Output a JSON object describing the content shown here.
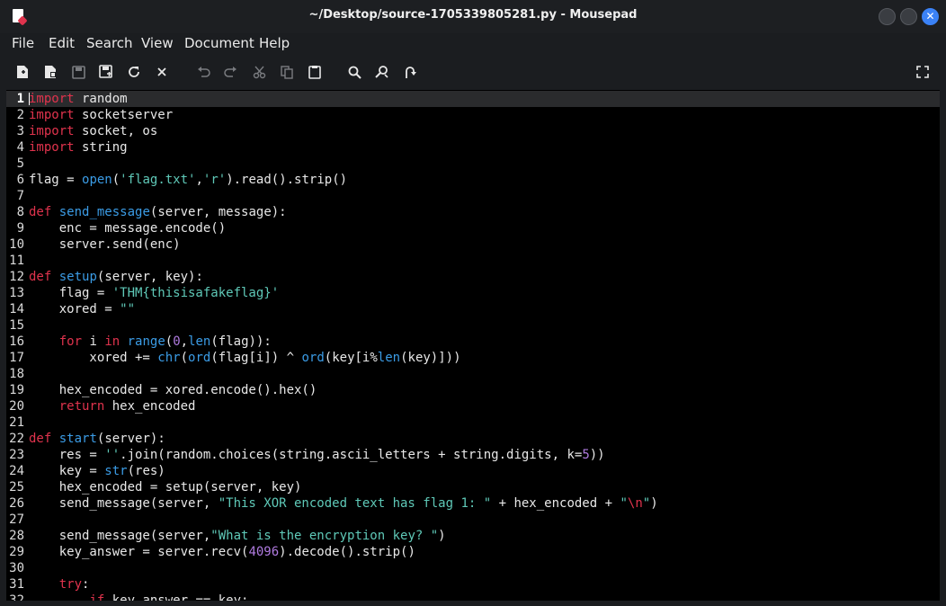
{
  "window": {
    "title": "~/Desktop/source-1705339805281.py - Mousepad",
    "close_glyph": "✕"
  },
  "menu": [
    "File",
    "Edit",
    "Search",
    "View",
    "Document",
    "Help"
  ],
  "toolbar": {
    "new_icon": "new-document-icon",
    "new_window_icon": "new-window-icon",
    "save_icon": "save-icon",
    "save_as_icon": "save-as-icon",
    "reload_icon": "reload-icon",
    "close_icon": "close-icon",
    "undo_icon": "undo-icon",
    "redo_icon": "redo-icon",
    "cut_icon": "cut-icon",
    "copy_icon": "copy-icon",
    "paste_icon": "paste-icon",
    "find_icon": "find-icon",
    "replace_icon": "find-replace-icon",
    "goto_icon": "go-to-line-icon",
    "fullscreen_icon": "fullscreen-icon"
  },
  "colors": {
    "keyword": "#e0334d",
    "function": "#3b9ce6",
    "string": "#5fc9b8",
    "number": "#b07be0",
    "accent": "#3b82f6"
  },
  "editor": {
    "current_line": 1,
    "lines": [
      [
        [
          "kw",
          "import"
        ],
        [
          "p",
          " random"
        ]
      ],
      [
        [
          "kw",
          "import"
        ],
        [
          "p",
          " socketserver"
        ]
      ],
      [
        [
          "kw",
          "import"
        ],
        [
          "p",
          " socket, os"
        ]
      ],
      [
        [
          "kw",
          "import"
        ],
        [
          "p",
          " string"
        ]
      ],
      [],
      [
        [
          "p",
          "flag = "
        ],
        [
          "fn",
          "open"
        ],
        [
          "p",
          "("
        ],
        [
          "str",
          "'flag.txt'"
        ],
        [
          "p",
          ","
        ],
        [
          "str",
          "'r'"
        ],
        [
          "p",
          ").read().strip()"
        ]
      ],
      [],
      [
        [
          "kw",
          "def"
        ],
        [
          "p",
          " "
        ],
        [
          "fn",
          "send_message"
        ],
        [
          "p",
          "(server, message):"
        ]
      ],
      [
        [
          "p",
          "    enc = message.encode()"
        ]
      ],
      [
        [
          "p",
          "    server.send(enc)"
        ]
      ],
      [],
      [
        [
          "kw",
          "def"
        ],
        [
          "p",
          " "
        ],
        [
          "fn",
          "setup"
        ],
        [
          "p",
          "(server, key):"
        ]
      ],
      [
        [
          "p",
          "    flag = "
        ],
        [
          "str",
          "'THM{thisisafakeflag}'"
        ]
      ],
      [
        [
          "p",
          "    xored = "
        ],
        [
          "str",
          "\"\""
        ]
      ],
      [],
      [
        [
          "p",
          "    "
        ],
        [
          "kw",
          "for"
        ],
        [
          "p",
          " i "
        ],
        [
          "kw",
          "in"
        ],
        [
          "p",
          " "
        ],
        [
          "fn",
          "range"
        ],
        [
          "p",
          "("
        ],
        [
          "num",
          "0"
        ],
        [
          "p",
          ","
        ],
        [
          "fn",
          "len"
        ],
        [
          "p",
          "(flag)):"
        ]
      ],
      [
        [
          "p",
          "        xored += "
        ],
        [
          "fn",
          "chr"
        ],
        [
          "p",
          "("
        ],
        [
          "fn",
          "ord"
        ],
        [
          "p",
          "(flag[i]) ^ "
        ],
        [
          "fn",
          "ord"
        ],
        [
          "p",
          "(key[i%"
        ],
        [
          "fn",
          "len"
        ],
        [
          "p",
          "(key)]))"
        ]
      ],
      [],
      [
        [
          "p",
          "    hex_encoded = xored.encode().hex()"
        ]
      ],
      [
        [
          "p",
          "    "
        ],
        [
          "kw",
          "return"
        ],
        [
          "p",
          " hex_encoded"
        ]
      ],
      [],
      [
        [
          "kw",
          "def"
        ],
        [
          "p",
          " "
        ],
        [
          "fn",
          "start"
        ],
        [
          "p",
          "(server):"
        ]
      ],
      [
        [
          "p",
          "    res = "
        ],
        [
          "str",
          "''"
        ],
        [
          "p",
          ".join(random.choices(string.ascii_letters + string.digits, k="
        ],
        [
          "num",
          "5"
        ],
        [
          "p",
          "))"
        ]
      ],
      [
        [
          "p",
          "    key = "
        ],
        [
          "fn",
          "str"
        ],
        [
          "p",
          "(res)"
        ]
      ],
      [
        [
          "p",
          "    hex_encoded = setup(server, key)"
        ]
      ],
      [
        [
          "p",
          "    send_message(server, "
        ],
        [
          "str",
          "\"This XOR encoded text has flag 1: \""
        ],
        [
          "p",
          " + hex_encoded + "
        ],
        [
          "str",
          "\""
        ],
        [
          "esc",
          "\\n"
        ],
        [
          "str",
          "\""
        ],
        [
          "p",
          ")"
        ]
      ],
      [],
      [
        [
          "p",
          "    send_message(server,"
        ],
        [
          "str",
          "\"What is the encryption key? \""
        ],
        [
          "p",
          ")"
        ]
      ],
      [
        [
          "p",
          "    key_answer = server.recv("
        ],
        [
          "num",
          "4096"
        ],
        [
          "p",
          ").decode().strip()"
        ]
      ],
      [],
      [
        [
          "p",
          "    "
        ],
        [
          "kw",
          "try"
        ],
        [
          "p",
          ":"
        ]
      ],
      [
        [
          "p",
          "        "
        ],
        [
          "kw",
          "if"
        ],
        [
          "p",
          " key_answer == key:"
        ]
      ]
    ]
  }
}
